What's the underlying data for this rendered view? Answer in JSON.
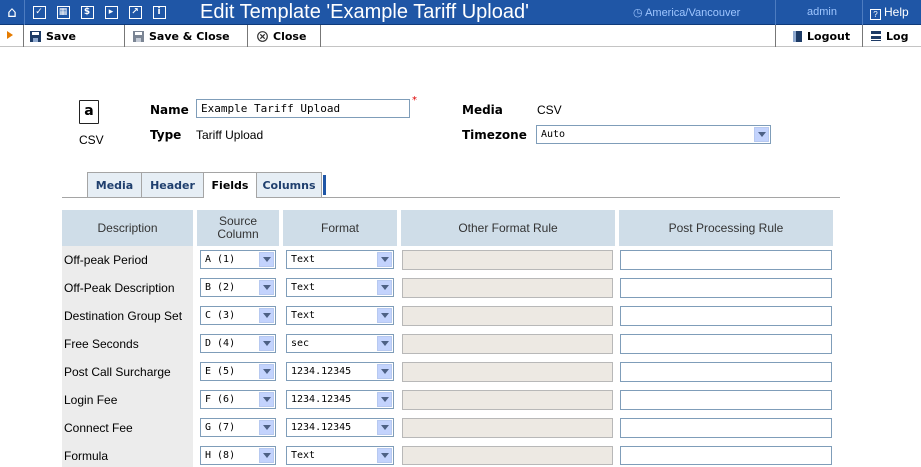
{
  "header": {
    "title": "Edit Template 'Example Tariff Upload'",
    "timezone": "America/Vancouver",
    "user": "admin",
    "help": "Help"
  },
  "toolbar": {
    "save": "Save",
    "save_close": "Save & Close",
    "close": "Close",
    "logout": "Logout",
    "log": "Log"
  },
  "form": {
    "file_type": "CSV",
    "name_label": "Name",
    "name_value": "Example Tariff Upload",
    "type_label": "Type",
    "type_value": "Tariff Upload",
    "media_label": "Media",
    "media_value": "CSV",
    "timezone_label": "Timezone",
    "timezone_value": "Auto"
  },
  "tabs": [
    {
      "label": "Media",
      "active": false
    },
    {
      "label": "Header",
      "active": false
    },
    {
      "label": "Fields",
      "active": true
    },
    {
      "label": "Columns",
      "active": false
    }
  ],
  "table": {
    "columns": [
      "Description",
      "Source Column",
      "Format",
      "Other Format Rule",
      "Post Processing Rule"
    ],
    "rows": [
      {
        "description": "Off-peak Period",
        "source": "A (1)",
        "format": "Text"
      },
      {
        "description": "Off-Peak Description",
        "source": "B (2)",
        "format": "Text"
      },
      {
        "description": "Destination Group Set",
        "source": "C (3)",
        "format": "Text"
      },
      {
        "description": "Free Seconds",
        "source": "D (4)",
        "format": "sec"
      },
      {
        "description": "Post Call Surcharge",
        "source": "E (5)",
        "format": "1234.12345"
      },
      {
        "description": "Login Fee",
        "source": "F (6)",
        "format": "1234.12345"
      },
      {
        "description": "Connect Fee",
        "source": "G (7)",
        "format": "1234.12345"
      },
      {
        "description": "Formula",
        "source": "H (8)",
        "format": "Text"
      }
    ]
  },
  "colors": {
    "title_bar": "#1f56a6",
    "header_cell": "#cfdde8",
    "label_cell": "#ececec",
    "accent": "#e57b00"
  }
}
